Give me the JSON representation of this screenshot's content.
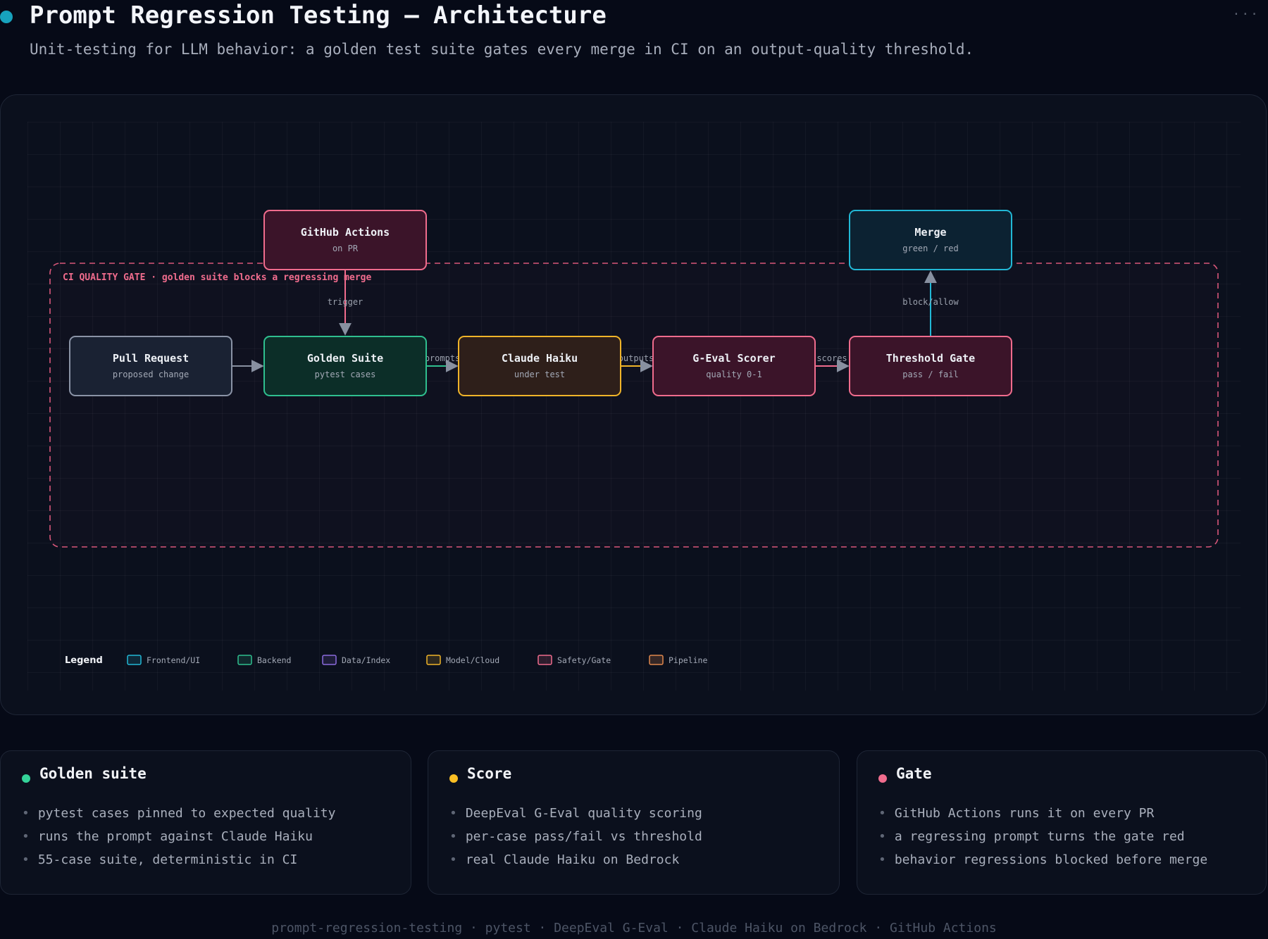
{
  "header": {
    "title": "Prompt Regression Testing — Architecture",
    "subtitle": "Unit-testing for LLM behavior: a golden test suite gates every merge in CI on an output-quality threshold."
  },
  "diagram": {
    "group_label": "CI QUALITY GATE · golden suite blocks a regressing merge",
    "nodes": {
      "github_actions": {
        "title": "GitHub Actions",
        "sub": "on PR"
      },
      "merge": {
        "title": "Merge",
        "sub": "green / red"
      },
      "pull_request": {
        "title": "Pull Request",
        "sub": "proposed change"
      },
      "golden_suite": {
        "title": "Golden Suite",
        "sub": "pytest cases"
      },
      "claude_haiku": {
        "title": "Claude Haiku",
        "sub": "under test"
      },
      "geval_scorer": {
        "title": "G-Eval Scorer",
        "sub": "quality 0-1"
      },
      "threshold_gate": {
        "title": "Threshold Gate",
        "sub": "pass / fail"
      }
    },
    "edges": {
      "trigger": "trigger",
      "block_allow": "block/allow",
      "prompts": "prompts",
      "outputs": "outputs",
      "scores": "scores"
    },
    "legend": {
      "title": "Legend",
      "items": [
        "Frontend/UI",
        "Backend",
        "Data/Index",
        "Model/Cloud",
        "Safety/Gate",
        "Pipeline"
      ]
    },
    "colors": {
      "frontend": "#22b8d6",
      "backend": "#2fbf8f",
      "data": "#8b6bdd",
      "model": "#f0b429",
      "safety": "#f06c8d",
      "pipeline": "#e0874d"
    }
  },
  "cards": [
    {
      "title": "Golden suite",
      "color": "#34d399",
      "items": [
        "pytest cases pinned to expected quality",
        "runs the prompt against Claude Haiku",
        "55-case suite, deterministic in CI"
      ]
    },
    {
      "title": "Score",
      "color": "#fbbf24",
      "items": [
        "DeepEval G-Eval quality scoring",
        "per-case pass/fail vs threshold",
        "real Claude Haiku on Bedrock"
      ]
    },
    {
      "title": "Gate",
      "color": "#f06c8d",
      "items": [
        "GitHub Actions runs it on every PR",
        "a regressing prompt turns the gate red",
        "behavior regressions blocked before merge"
      ]
    }
  ],
  "footer": "prompt-regression-testing · pytest · DeepEval G-Eval · Claude Haiku on Bedrock · GitHub Actions"
}
